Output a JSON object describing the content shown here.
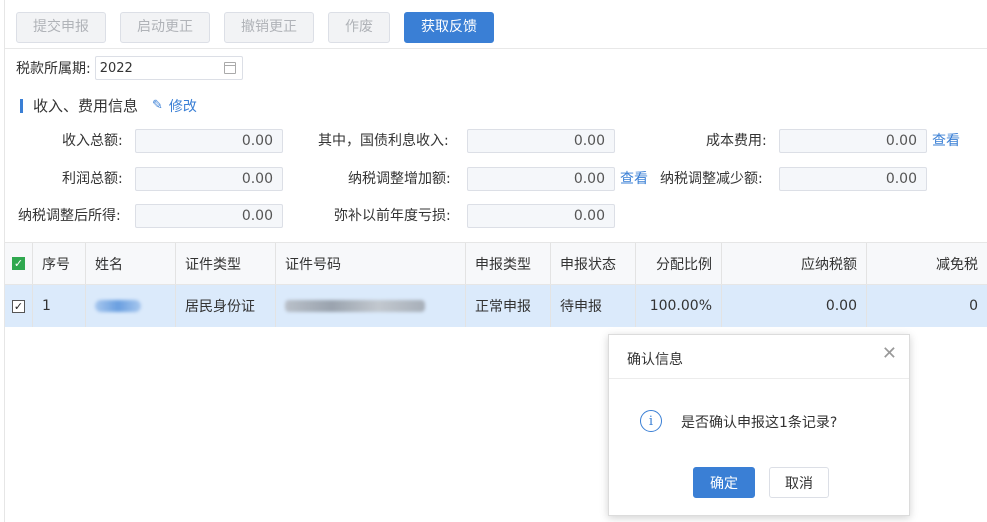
{
  "toolbar": {
    "submit": "提交申报",
    "start_correction": "启动更正",
    "revoke_correction": "撤销更正",
    "void": "作废",
    "get_feedback": "获取反馈"
  },
  "period": {
    "label": "税款所属期:",
    "value": "2022"
  },
  "section": {
    "title": "收入、费用信息",
    "edit": "修改"
  },
  "fields": {
    "total_income_label": "收入总额:",
    "total_income": "0.00",
    "treasury_interest_label": "其中，国债利息收入:",
    "treasury_interest": "0.00",
    "cost_label": "成本费用:",
    "cost": "0.00",
    "total_profit_label": "利润总额:",
    "total_profit": "0.00",
    "tax_adj_increase_label": "纳税调整增加额:",
    "tax_adj_increase": "0.00",
    "tax_adj_decrease_label": "纳税调整减少额:",
    "tax_adj_decrease": "0.00",
    "adjusted_income_label": "纳税调整后所得:",
    "adjusted_income": "0.00",
    "prior_loss_label": "弥补以前年度亏损:",
    "prior_loss": "0.00",
    "view": "查看"
  },
  "table": {
    "headers": [
      "序号",
      "姓名",
      "证件类型",
      "证件号码",
      "申报类型",
      "申报状态",
      "分配比例",
      "应纳税额",
      "减免税"
    ],
    "rows": [
      {
        "index": "1",
        "id_type": "居民身份证",
        "report_type": "正常申报",
        "report_status": "待申报",
        "ratio": "100.00%",
        "tax_payable": "0.00",
        "tax_relief": "0"
      }
    ]
  },
  "dialog": {
    "title": "确认信息",
    "close": "✕",
    "message": "是否确认申报这1条记录?",
    "ok": "确定",
    "cancel": "取消"
  },
  "colors": {
    "accent": "#3a7fd5",
    "selected_row": "#dbeafb",
    "checkbox_green": "#2fa84f"
  }
}
